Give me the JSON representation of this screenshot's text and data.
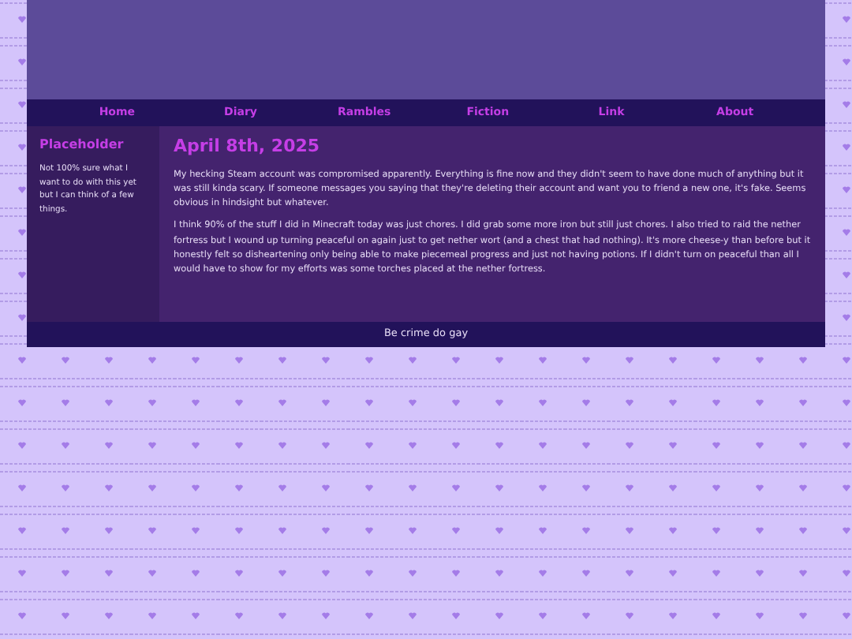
{
  "nav": [
    {
      "label": "Home"
    },
    {
      "label": "Diary"
    },
    {
      "label": "Rambles"
    },
    {
      "label": "Fiction"
    },
    {
      "label": "Link"
    },
    {
      "label": "About"
    }
  ],
  "sidebar": {
    "title": "Placeholder",
    "text": "Not 100% sure what I want to do with this yet but I can think of a few things."
  },
  "post": {
    "title": "April 8th, 2025",
    "paragraphs": [
      "My hecking Steam account was compromised apparently. Everything is fine now and they didn't seem to have done much of anything but it was still kinda scary. If someone messages you saying that they're deleting their account and want you to friend a new one, it's fake. Seems obvious in hindsight but whatever.",
      "I think 90% of the stuff I did in Minecraft today was just chores. I did grab some more iron but still just chores. I also tried to raid the nether fortress but I wound up turning peaceful on again just to get nether wort (and a chest that had nothing). It's more cheese-y than before but it honestly felt so disheartening only being able to make piecemeal progress and just not having potions. If I didn't turn on peaceful than all I would have to show for my efforts was some torches placed at the nether fortress."
    ]
  },
  "footer": "Be crime do gay"
}
